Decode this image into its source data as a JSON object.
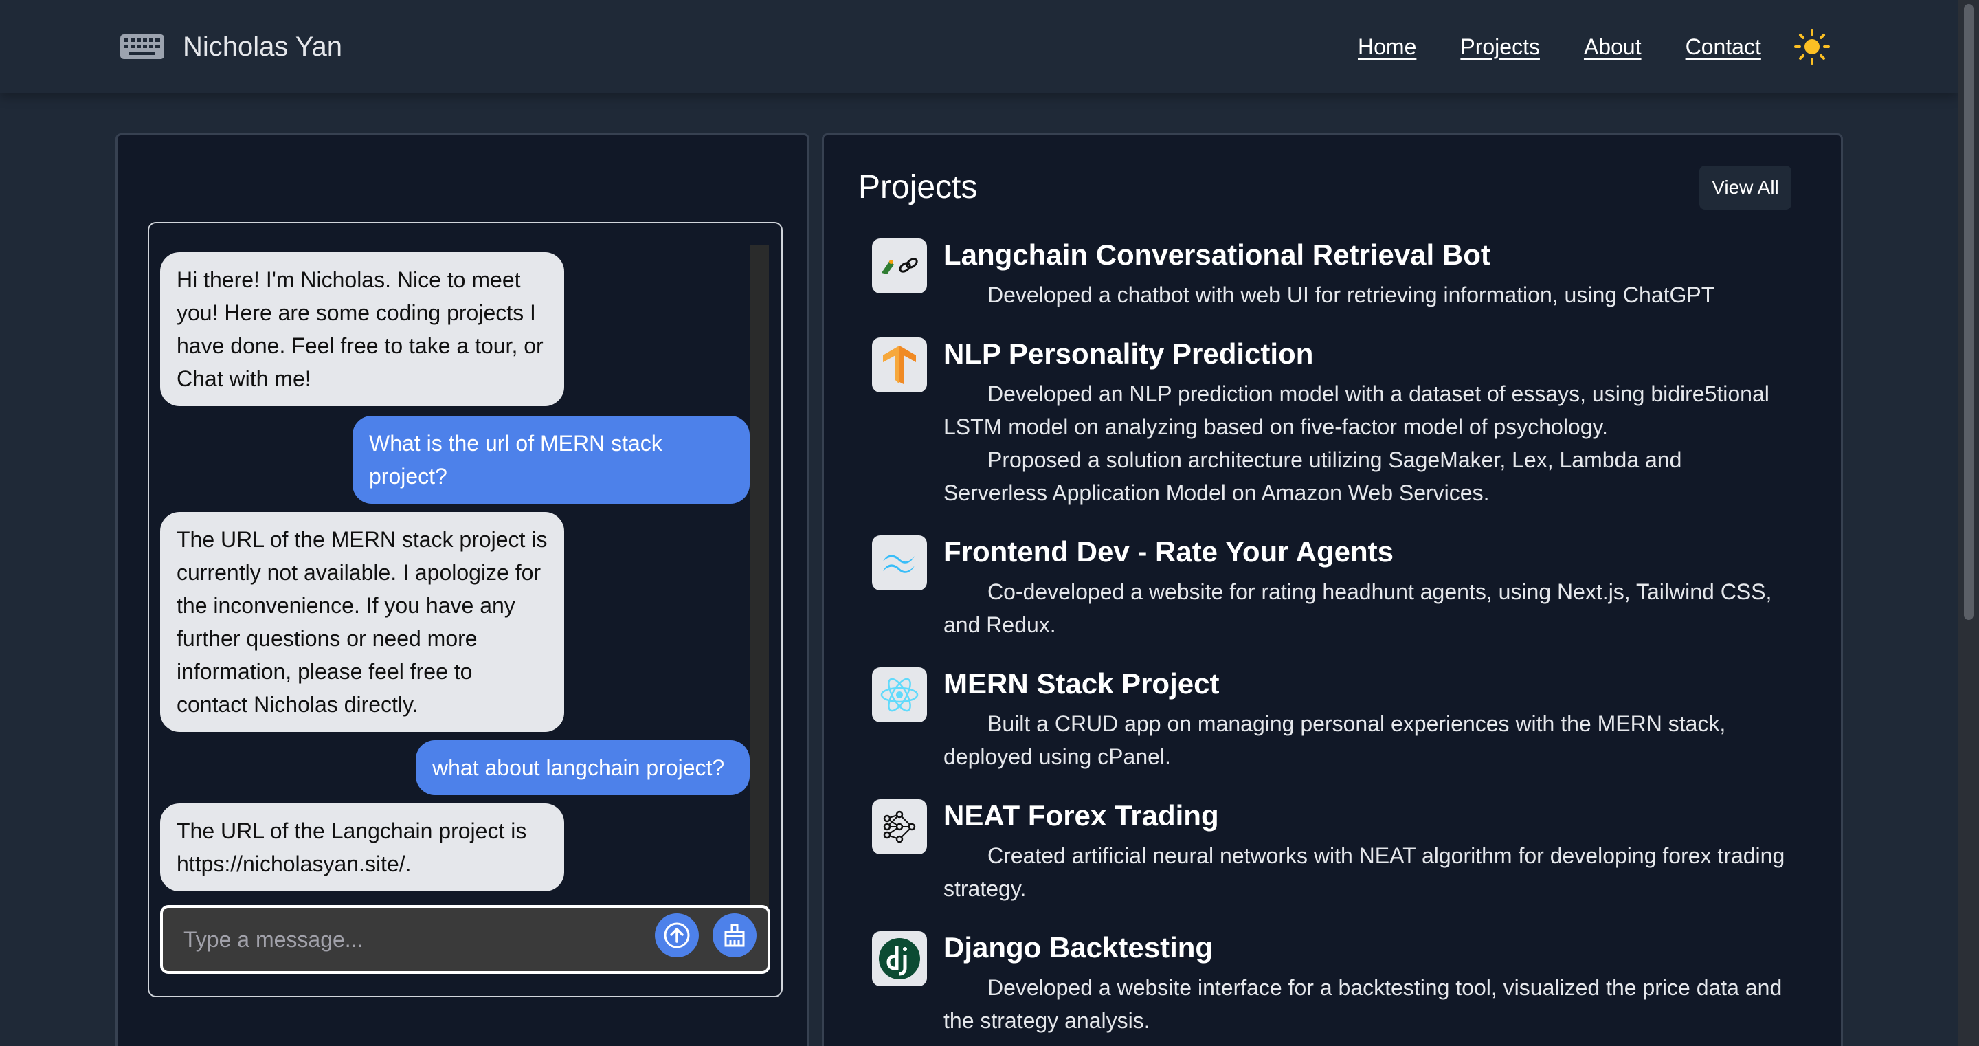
{
  "header": {
    "brand_name": "Nicholas Yan",
    "nav": [
      "Home",
      "Projects",
      "About",
      "Contact"
    ],
    "theme_icon": "sun-icon",
    "brand_icon": "keyboard-icon"
  },
  "chat": {
    "messages": [
      {
        "role": "bot",
        "text": "Hi there! I'm Nicholas. Nice to meet you! Here are some coding projects I have done. Feel free to take a tour, or Chat with me!"
      },
      {
        "role": "user",
        "text": "What is the url of MERN stack project?"
      },
      {
        "role": "bot",
        "text": "The URL of the MERN stack project is currently not available. I apologize for the inconvenience. If you have any further questions or need more information, please feel free to contact Nicholas directly."
      },
      {
        "role": "user",
        "text": "what about langchain project?"
      },
      {
        "role": "bot",
        "text": "The URL of the Langchain project is https://nicholasyan.site/."
      }
    ],
    "input_placeholder": "Type a message...",
    "input_value": "",
    "send_icon": "send-arrow-icon",
    "clear_icon": "broom-icon"
  },
  "projects": {
    "title": "Projects",
    "view_all_label": "View All",
    "items": [
      {
        "name": "Langchain Conversational Retrieval Bot",
        "icon": "langchain-logo-icon",
        "desc": [
          "Developed a chatbot with web UI for retrieving information, using ChatGPT"
        ]
      },
      {
        "name": "NLP Personality Prediction",
        "icon": "tensorflow-logo-icon",
        "desc": [
          "Developed an NLP prediction model with a dataset of essays, using bidire5tional LSTM model on analyzing based on five-factor model of psychology.",
          "Proposed a solution architecture utilizing SageMaker, Lex, Lambda and Serverless Application Model on Amazon Web Services."
        ]
      },
      {
        "name": "Frontend Dev - Rate Your Agents",
        "icon": "tailwind-logo-icon",
        "desc": [
          "Co-developed a website for rating headhunt agents, using Next.js, Tailwind CSS, and Redux."
        ]
      },
      {
        "name": "MERN Stack Project",
        "icon": "react-logo-icon",
        "desc": [
          "Built a CRUD app on managing personal experiences with the MERN stack, deployed using cPanel."
        ]
      },
      {
        "name": "NEAT Forex Trading",
        "icon": "neural-network-icon",
        "desc": [
          "Created artificial neural networks with NEAT algorithm for developing forex trading strategy."
        ]
      },
      {
        "name": "Django Backtesting",
        "icon": "django-logo-icon",
        "desc": [
          "Developed a website interface for a backtesting tool, visualized the price data and the strategy analysis."
        ]
      }
    ]
  },
  "colors": {
    "page_bg": "#1f2937",
    "card_bg": "#111827",
    "accent": "#4d81ea",
    "bot_bubble": "#e5e7eb"
  }
}
